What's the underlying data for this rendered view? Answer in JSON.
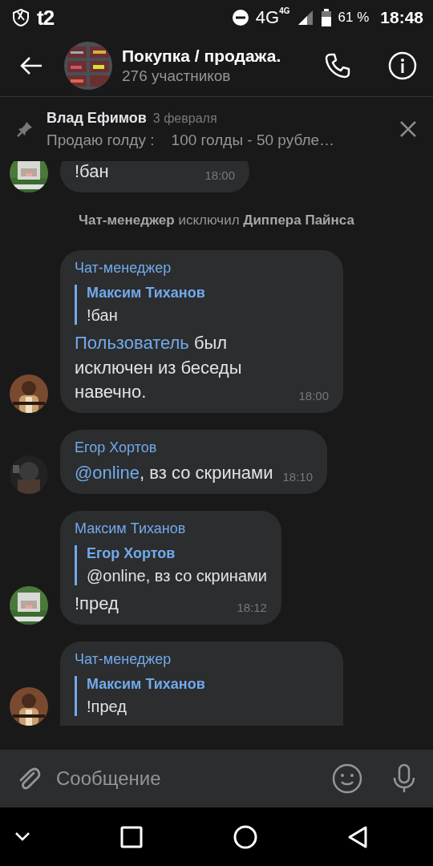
{
  "status_bar": {
    "carrier": "t2",
    "network": "4G",
    "network_small": "4G",
    "battery": "61 %",
    "time": "18:48"
  },
  "header": {
    "title": "Покупка / продажа.",
    "subtitle": "276 участников"
  },
  "pinned": {
    "author": "Влад Ефимов",
    "date": "3 февраля",
    "text": "Продаю голду :    100 голды - 50 рубле…"
  },
  "messages": [
    {
      "kind": "message",
      "body": [
        {
          "text": "!бан"
        }
      ],
      "time": "18:00"
    },
    {
      "kind": "service",
      "body": [
        {
          "text": "Чат-менеджер",
          "bold": true
        },
        {
          "text": " исключил "
        },
        {
          "text": "Диппера Пайнса",
          "bold": true
        }
      ]
    },
    {
      "kind": "message",
      "author": "Чат-менеджер",
      "quote": {
        "author": "Максим Тиханов",
        "text": "!бан"
      },
      "body": [
        {
          "text": "Пользователь",
          "link": true
        },
        {
          "text": " был исключен из беседы навечно."
        }
      ],
      "time": "18:00"
    },
    {
      "kind": "message",
      "author": "Егор Хортов",
      "body": [
        {
          "text": "@online",
          "link": true
        },
        {
          "text": ", вз со скринами"
        }
      ],
      "time": "18:10"
    },
    {
      "kind": "message",
      "author": "Максим Тиханов",
      "quote": {
        "author": "Егор Хортов",
        "text": "@online, вз со скринами"
      },
      "body": [
        {
          "text": "!пред"
        }
      ],
      "time": "18:12"
    },
    {
      "kind": "message",
      "author": "Чат-менеджер",
      "quote": {
        "author": "Максим Тиханов",
        "text": "!пред"
      }
    }
  ],
  "composer": {
    "placeholder": "Сообщение"
  }
}
